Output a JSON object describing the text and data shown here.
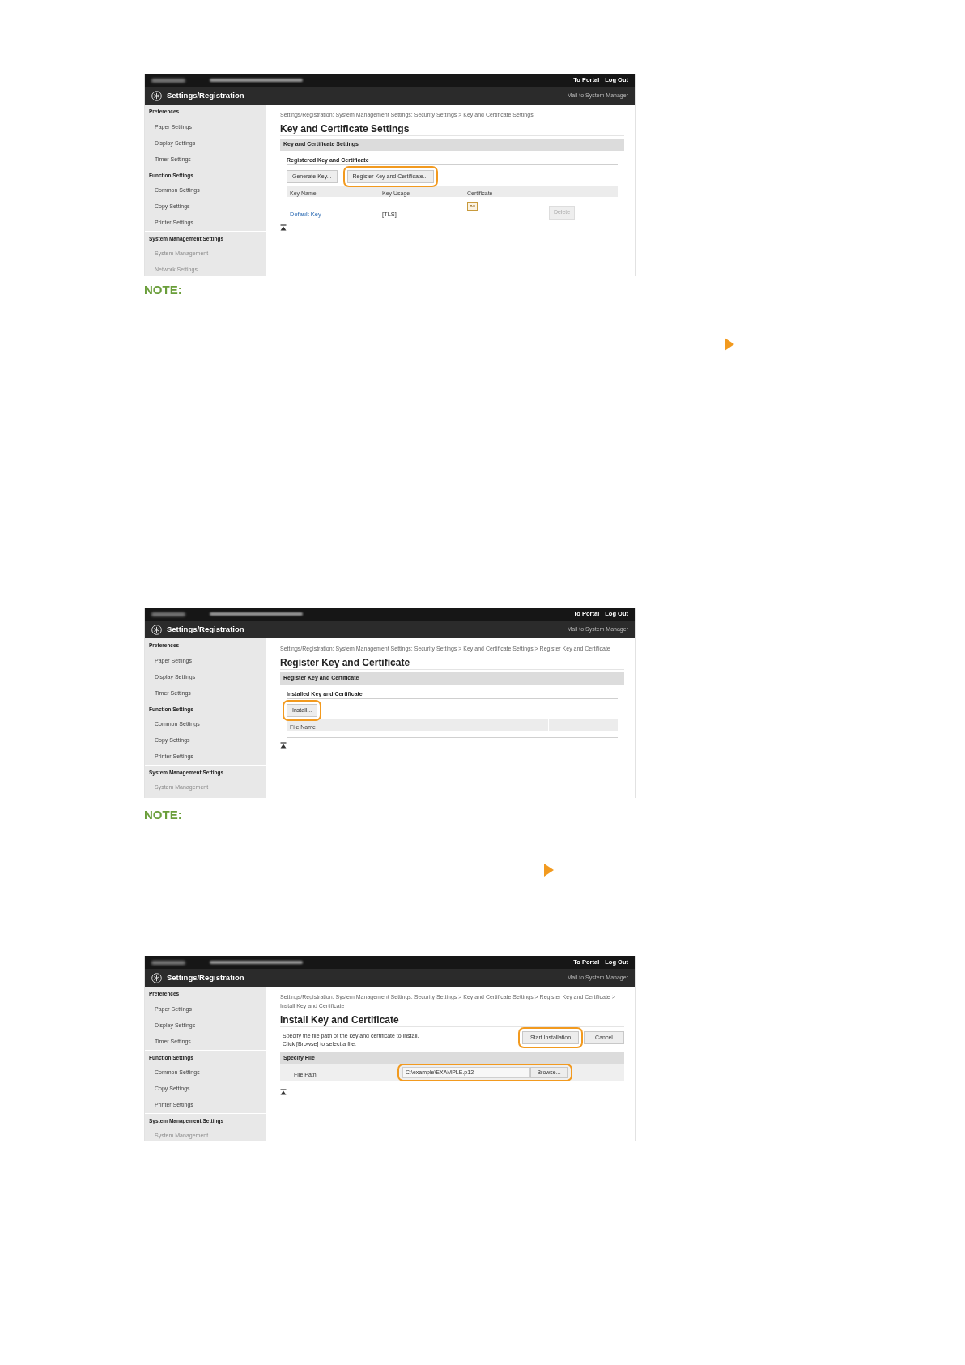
{
  "screenshots": [
    {
      "header": {
        "links": [
          "To Portal",
          "Log Out"
        ],
        "title": "Settings/Registration",
        "mail": "Mail to System Manager"
      },
      "sidebar": [
        {
          "heading": "Preferences",
          "items": [
            {
              "label": "Paper Settings",
              "faded": false
            },
            {
              "label": "Display Settings",
              "faded": false
            },
            {
              "label": "Timer Settings",
              "faded": false
            }
          ]
        },
        {
          "heading": "Function Settings",
          "items": [
            {
              "label": "Common Settings",
              "faded": false
            },
            {
              "label": "Copy Settings",
              "faded": false
            },
            {
              "label": "Printer Settings",
              "faded": false
            }
          ]
        },
        {
          "heading": "System Management Settings",
          "items": [
            {
              "label": "System Management",
              "faded": true
            },
            {
              "label": "Network Settings",
              "faded": true
            }
          ]
        }
      ],
      "breadcrumb": "Settings/Registration: System Management Settings: Security Settings > Key and Certificate Settings",
      "page_title": "Key and Certificate Settings",
      "blocks": [
        {
          "kind": "bar",
          "text": "Key and Certificate Settings"
        },
        {
          "kind": "subheading",
          "text": "Registered Key and Certificate"
        },
        {
          "kind": "buttons",
          "buttons": [
            {
              "label": "Generate Key...",
              "highlighted": false
            },
            {
              "label": "Register Key and Certificate...",
              "highlighted": true
            }
          ]
        },
        {
          "kind": "table",
          "columns": [
            "Key Name",
            "Key Usage",
            "Certificate"
          ],
          "rows": [
            {
              "key_name": "Default Key",
              "key_usage": "[TLS]",
              "action": "Delete",
              "action_disabled": true
            }
          ]
        }
      ]
    },
    {
      "header": {
        "links": [
          "To Portal",
          "Log Out"
        ],
        "title": "Settings/Registration",
        "mail": "Mail to System Manager"
      },
      "sidebar": [
        {
          "heading": "Preferences",
          "items": [
            {
              "label": "Paper Settings",
              "faded": false
            },
            {
              "label": "Display Settings",
              "faded": false
            },
            {
              "label": "Timer Settings",
              "faded": false
            }
          ]
        },
        {
          "heading": "Function Settings",
          "items": [
            {
              "label": "Common Settings",
              "faded": false
            },
            {
              "label": "Copy Settings",
              "faded": false
            },
            {
              "label": "Printer Settings",
              "faded": false
            }
          ]
        },
        {
          "heading": "System Management Settings",
          "items": [
            {
              "label": "System Management",
              "faded": true
            }
          ]
        }
      ],
      "breadcrumb": "Settings/Registration: System Management Settings: Security Settings > Key and Certificate Settings > Register Key and Certificate",
      "page_title": "Register Key and Certificate",
      "blocks": [
        {
          "kind": "bar",
          "text": "Register Key and Certificate"
        },
        {
          "kind": "subheading",
          "text": "Installed Key and Certificate"
        },
        {
          "kind": "buttons",
          "buttons": [
            {
              "label": "Install...",
              "highlighted": true
            }
          ]
        },
        {
          "kind": "table",
          "columns": [
            "File Name"
          ]
        }
      ]
    },
    {
      "header": {
        "links": [
          "To Portal",
          "Log Out"
        ],
        "title": "Settings/Registration",
        "mail": "Mail to System Manager"
      },
      "sidebar": [
        {
          "heading": "Preferences",
          "items": [
            {
              "label": "Paper Settings",
              "faded": false
            },
            {
              "label": "Display Settings",
              "faded": false
            },
            {
              "label": "Timer Settings",
              "faded": false
            }
          ]
        },
        {
          "heading": "Function Settings",
          "items": [
            {
              "label": "Common Settings",
              "faded": false
            },
            {
              "label": "Copy Settings",
              "faded": false
            },
            {
              "label": "Printer Settings",
              "faded": false
            }
          ]
        },
        {
          "heading": "System Management Settings",
          "items": [
            {
              "label": "System Management",
              "faded": true
            }
          ]
        }
      ],
      "breadcrumb": "Settings/Registration: System Management Settings: Security Settings > Key and Certificate Settings > Register Key and Certificate > Install Key and Certificate",
      "page_title": "Install Key and Certificate",
      "blocks": [
        {
          "kind": "instructions",
          "lines": [
            "Specify the file path of the key and certificate to install.",
            "Click [Browse] to select a file."
          ],
          "buttons": [
            {
              "label": "Start Installation",
              "highlighted": true
            },
            {
              "label": "Cancel",
              "highlighted": false
            }
          ]
        },
        {
          "kind": "bar",
          "text": "Specify File"
        },
        {
          "kind": "file_row",
          "label": "File Path:",
          "value": "C:\\example\\EXAMPLE.p12",
          "button": "Browse...",
          "highlighted": true
        }
      ]
    }
  ],
  "notes": [
    {
      "label": "NOTE:"
    },
    {
      "label": "NOTE:"
    }
  ]
}
